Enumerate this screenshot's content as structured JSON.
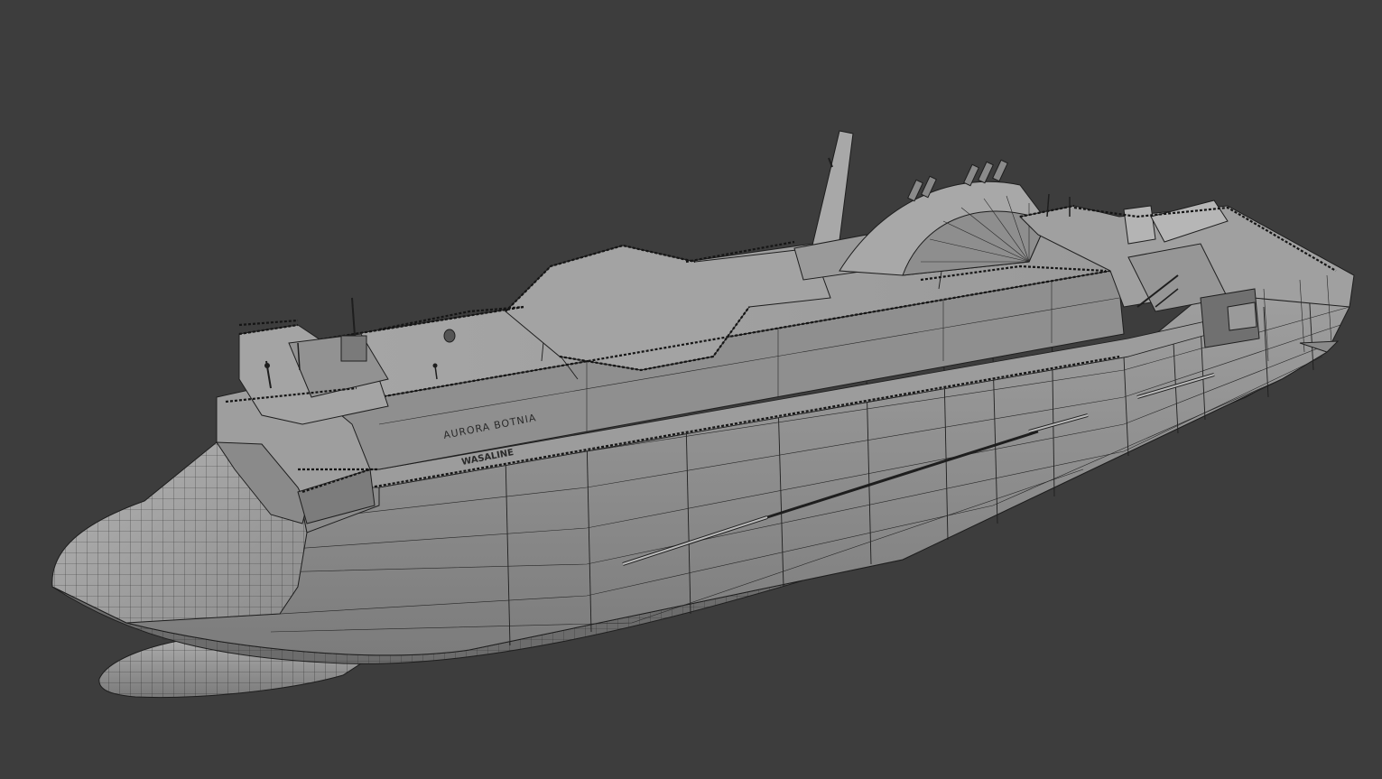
{
  "viewport": {
    "background": "#3d3d3d",
    "mode": "solid-wireframe",
    "object": "ship-model"
  },
  "ship": {
    "name_label": "AURORA BOTNIA",
    "operator_logo": "WASALINE",
    "hull_color": "#8e8e8e",
    "deck_color": "#9a9a9a",
    "bow_color": "#9c9c9c",
    "wire_color": "#1e1e1e"
  }
}
